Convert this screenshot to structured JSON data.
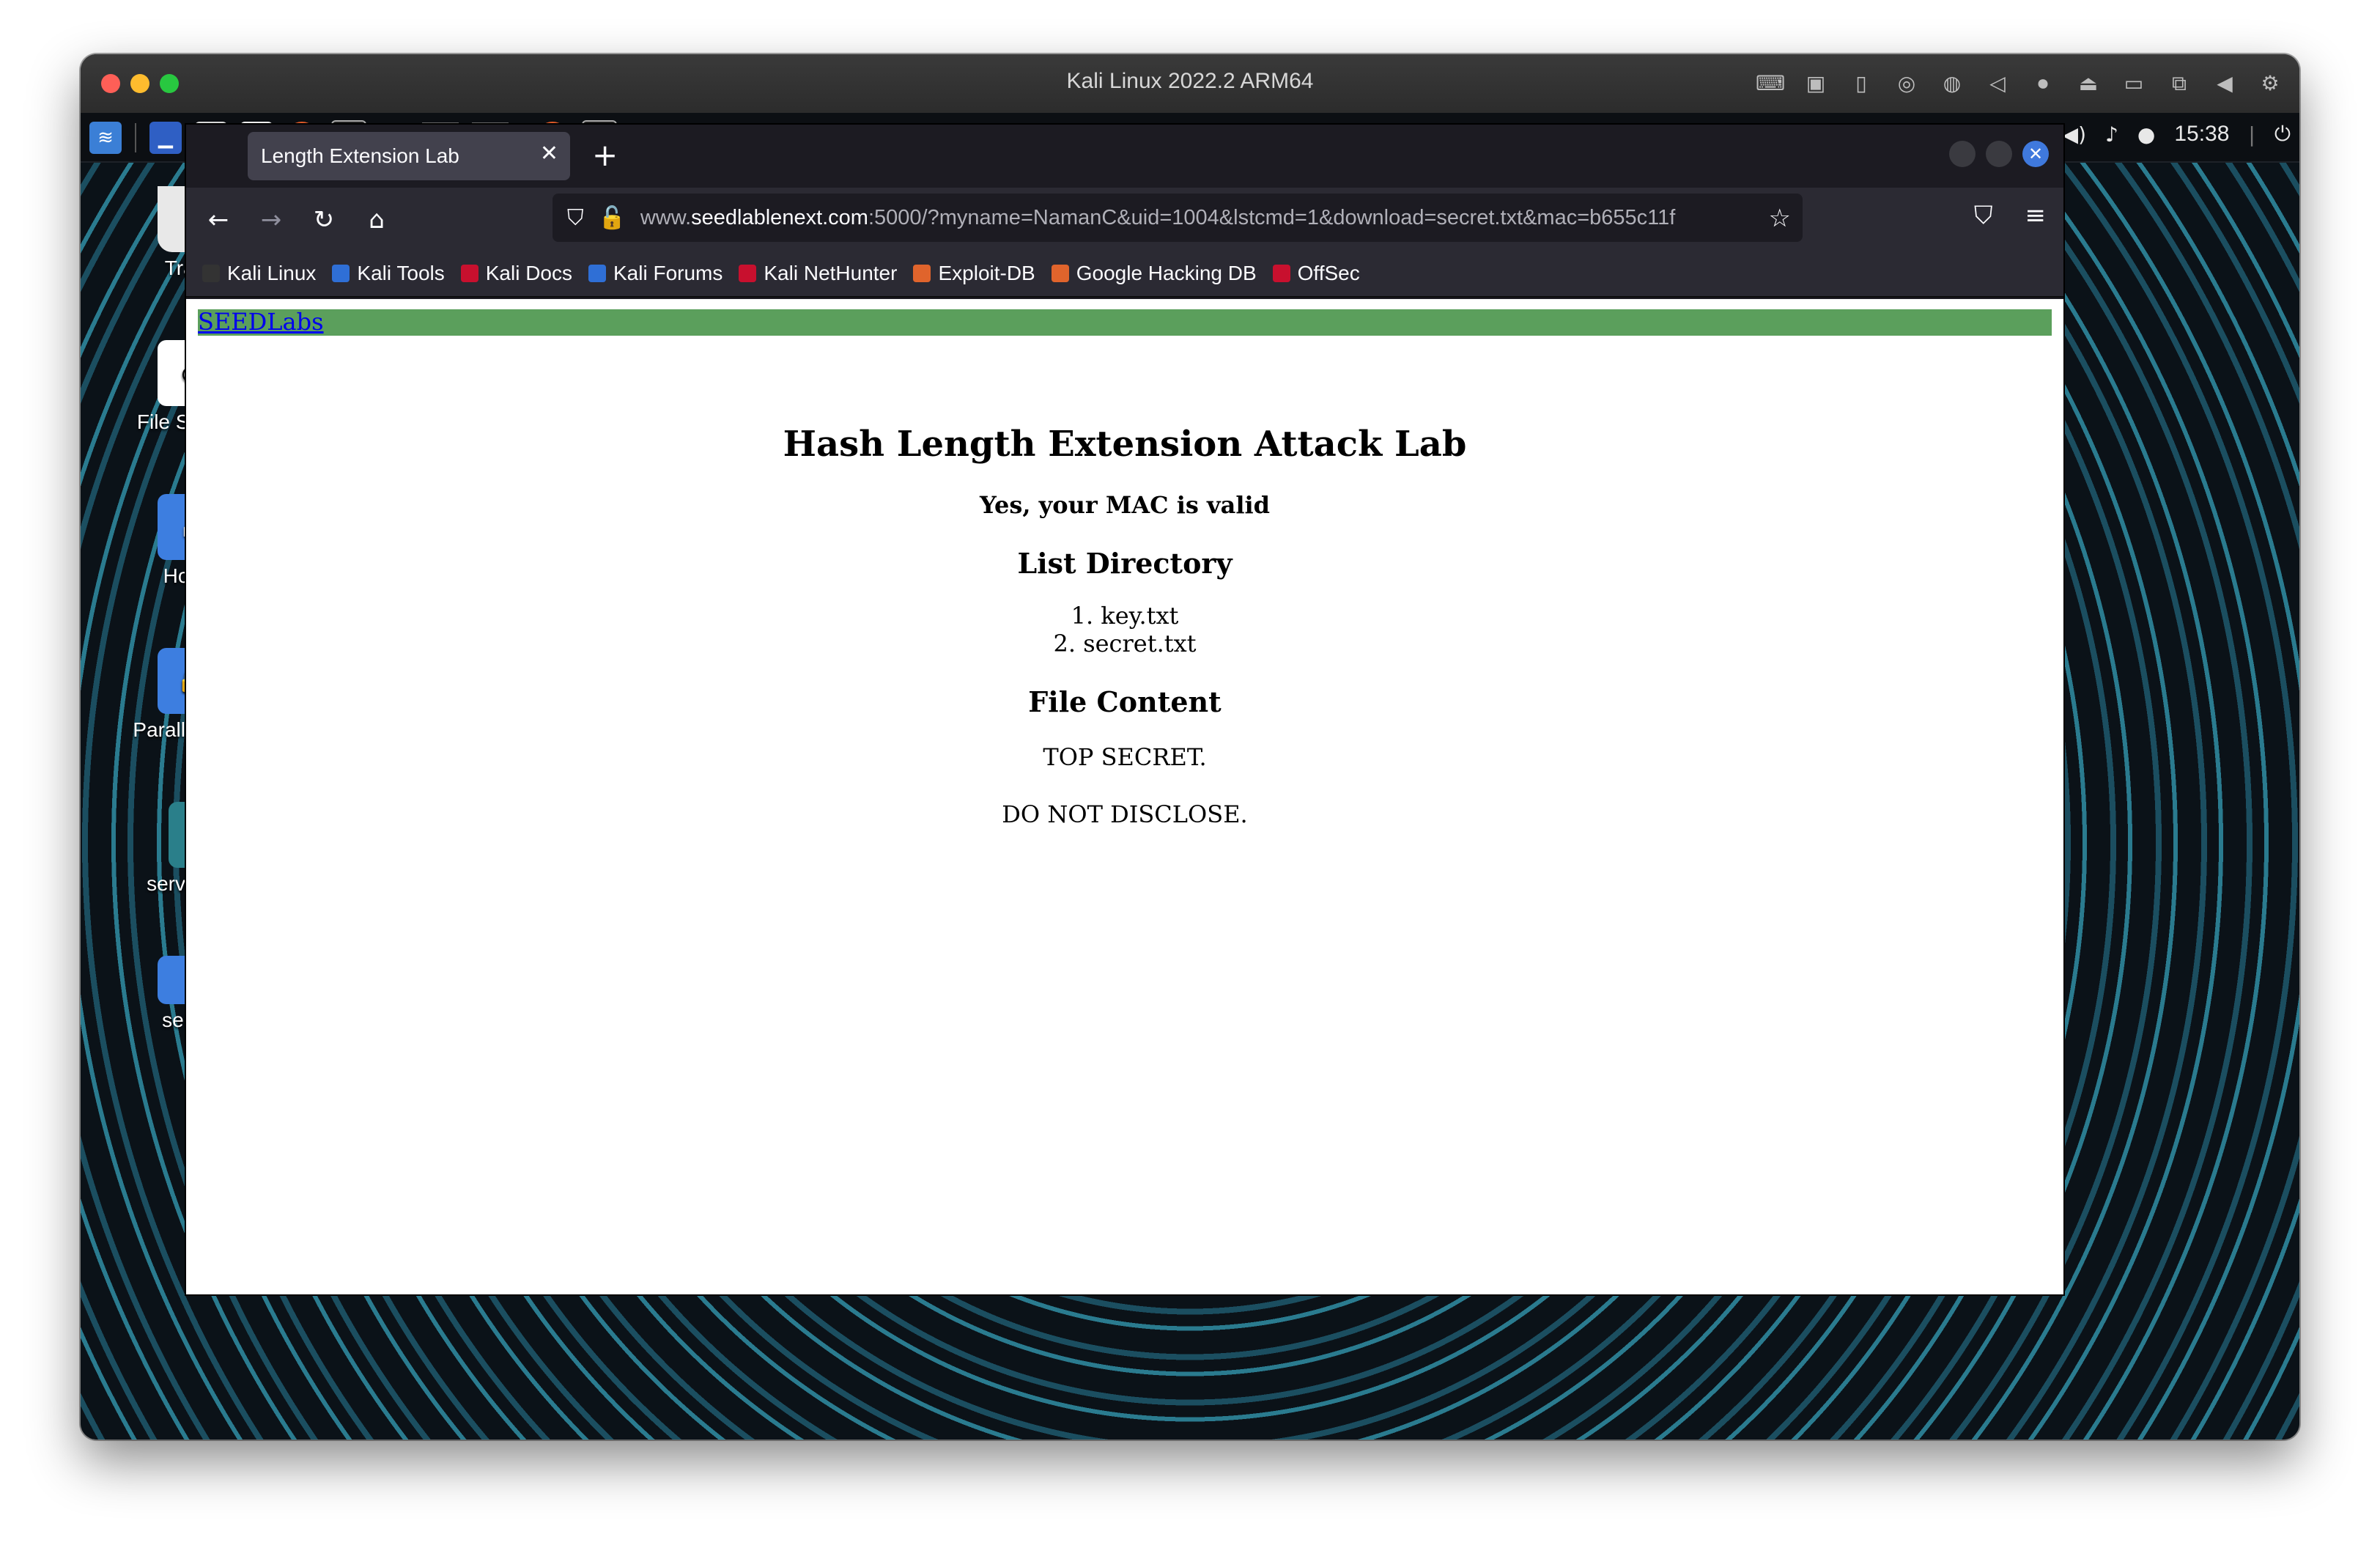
{
  "vm": {
    "title": "Kali Linux 2022.2 ARM64"
  },
  "panel": {
    "clock": "15:38"
  },
  "desktop_icons": [
    {
      "label": "Trash"
    },
    {
      "label": "File System"
    },
    {
      "label": "Home"
    },
    {
      "label": "Parallels S..."
    },
    {
      "label": "server.zip"
    },
    {
      "label": "server"
    }
  ],
  "browser": {
    "tab_title": "Length Extension Lab",
    "url_prefix": "www.",
    "url_host": "seedlablenext.com",
    "url_rest": ":5000/?myname=NamanC&uid=1004&lstcmd=1&download=secret.txt&mac=b655c11f",
    "bookmarks": [
      {
        "label": "Kali Linux",
        "color": "#333333"
      },
      {
        "label": "Kali Tools",
        "color": "#2f6fd6"
      },
      {
        "label": "Kali Docs",
        "color": "#c8102e"
      },
      {
        "label": "Kali Forums",
        "color": "#2f6fd6"
      },
      {
        "label": "Kali NetHunter",
        "color": "#c8102e"
      },
      {
        "label": "Exploit-DB",
        "color": "#e0642c"
      },
      {
        "label": "Google Hacking DB",
        "color": "#e0642c"
      },
      {
        "label": "OffSec",
        "color": "#c8102e"
      }
    ]
  },
  "page": {
    "banner_link": "SEEDLabs",
    "banner_color": "#5b9f5c",
    "title": "Hash Length Extension Attack Lab",
    "status": "Yes, your MAC is valid",
    "list_heading": "List Directory",
    "files": [
      "1. key.txt",
      "2. secret.txt"
    ],
    "content_heading": "File Content",
    "content_lines": [
      "TOP SECRET.",
      "DO NOT DISCLOSE."
    ]
  }
}
